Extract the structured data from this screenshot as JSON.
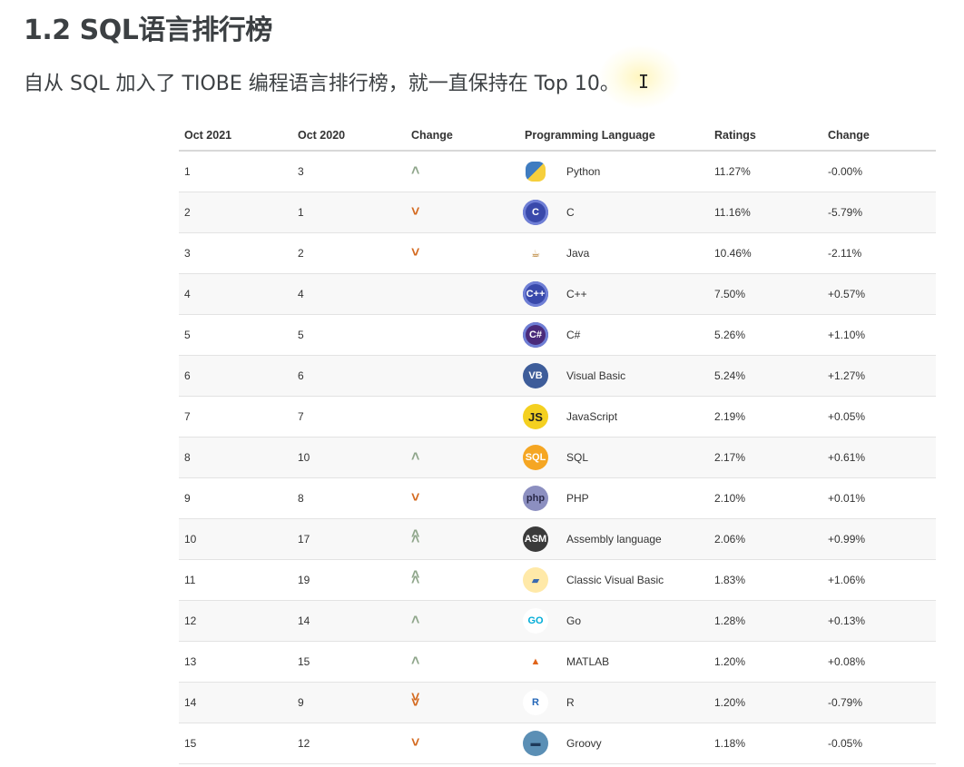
{
  "heading": "1.2 SQL语言排行榜",
  "intro": "自从 SQL 加入了 TIOBE 编程语言排行榜，就一直保持在 Top 10。",
  "cursor_glyph": "I",
  "colors": {
    "up": "#8fa68b",
    "down": "#d4691e"
  },
  "table": {
    "headers": [
      "Oct 2021",
      "Oct 2020",
      "Change",
      "Programming Language",
      "Ratings",
      "Change"
    ],
    "rows": [
      {
        "cur": "1",
        "prev": "3",
        "trend": "up",
        "lang": "Python",
        "logo": "python-logo",
        "rating": "11.27%",
        "change": "-0.00%"
      },
      {
        "cur": "2",
        "prev": "1",
        "trend": "down",
        "lang": "C",
        "logo": "c-logo",
        "rating": "11.16%",
        "change": "-5.79%"
      },
      {
        "cur": "3",
        "prev": "2",
        "trend": "down",
        "lang": "Java",
        "logo": "java-logo",
        "rating": "10.46%",
        "change": "-2.11%"
      },
      {
        "cur": "4",
        "prev": "4",
        "trend": "none",
        "lang": "C++",
        "logo": "cpp-logo",
        "rating": "7.50%",
        "change": "+0.57%"
      },
      {
        "cur": "5",
        "prev": "5",
        "trend": "none",
        "lang": "C#",
        "logo": "csharp-logo",
        "rating": "5.26%",
        "change": "+1.10%"
      },
      {
        "cur": "6",
        "prev": "6",
        "trend": "none",
        "lang": "Visual Basic",
        "logo": "visual-basic-logo",
        "rating": "5.24%",
        "change": "+1.27%"
      },
      {
        "cur": "7",
        "prev": "7",
        "trend": "none",
        "lang": "JavaScript",
        "logo": "javascript-logo",
        "rating": "2.19%",
        "change": "+0.05%"
      },
      {
        "cur": "8",
        "prev": "10",
        "trend": "up",
        "lang": "SQL",
        "logo": "sql-logo",
        "rating": "2.17%",
        "change": "+0.61%"
      },
      {
        "cur": "9",
        "prev": "8",
        "trend": "down",
        "lang": "PHP",
        "logo": "php-logo",
        "rating": "2.10%",
        "change": "+0.01%"
      },
      {
        "cur": "10",
        "prev": "17",
        "trend": "up2",
        "lang": "Assembly language",
        "logo": "assembly-logo",
        "rating": "2.06%",
        "change": "+0.99%"
      },
      {
        "cur": "11",
        "prev": "19",
        "trend": "up2",
        "lang": "Classic Visual Basic",
        "logo": "classic-visual-basic-logo",
        "rating": "1.83%",
        "change": "+1.06%"
      },
      {
        "cur": "12",
        "prev": "14",
        "trend": "up",
        "lang": "Go",
        "logo": "go-logo",
        "rating": "1.28%",
        "change": "+0.13%"
      },
      {
        "cur": "13",
        "prev": "15",
        "trend": "up",
        "lang": "MATLAB",
        "logo": "matlab-logo",
        "rating": "1.20%",
        "change": "+0.08%"
      },
      {
        "cur": "14",
        "prev": "9",
        "trend": "down2",
        "lang": "R",
        "logo": "r-logo",
        "rating": "1.20%",
        "change": "-0.79%"
      },
      {
        "cur": "15",
        "prev": "12",
        "trend": "down",
        "lang": "Groovy",
        "logo": "groovy-logo",
        "rating": "1.18%",
        "change": "-0.05%"
      }
    ]
  },
  "logo_styles": {
    "python-logo": {
      "bg": "linear-gradient(135deg,#3f7cc0 0%,#3f7cc0 50%,#f6cf3c 50%,#f6cf3c 100%)",
      "text": "",
      "color": "#fff",
      "radius": "8px",
      "size": "22px"
    },
    "c-logo": {
      "bg": "#3949ab",
      "text": "C",
      "color": "#fff",
      "radius": "50%"
    },
    "java-logo": {
      "bg": "#ffffff",
      "text": "☕",
      "color": "#b07219",
      "radius": "50%"
    },
    "cpp-logo": {
      "bg": "#3949ab",
      "text": "C++",
      "color": "#fff",
      "radius": "50%"
    },
    "csharp-logo": {
      "bg": "#4a2a7a",
      "text": "C#",
      "color": "#fff",
      "radius": "50%"
    },
    "visual-basic-logo": {
      "bg": "#3e5d9a",
      "text": "VB",
      "color": "#fff",
      "radius": "50%"
    },
    "javascript-logo": {
      "bg": "#f4d020",
      "text": "JS",
      "color": "#222",
      "radius": "50%"
    },
    "sql-logo": {
      "bg": "#f5a623",
      "text": "SQL",
      "color": "#fff",
      "radius": "50%"
    },
    "php-logo": {
      "bg": "#8c8fc0",
      "text": "php",
      "color": "#2a2a4a",
      "radius": "50%"
    },
    "assembly-logo": {
      "bg": "#3a3a3a",
      "text": "ASM",
      "color": "#fff",
      "radius": "50%"
    },
    "classic-visual-basic-logo": {
      "bg": "#ffe9a8",
      "text": "▰",
      "color": "#3a6ab0",
      "radius": "50%"
    },
    "go-logo": {
      "bg": "#ffffff",
      "text": "GO",
      "color": "#00acd7",
      "radius": "50%"
    },
    "matlab-logo": {
      "bg": "#ffffff",
      "text": "▲",
      "color": "#e0641a",
      "radius": "50%"
    },
    "r-logo": {
      "bg": "#ffffff",
      "text": "R",
      "color": "#2467b8",
      "radius": "50%"
    },
    "groovy-logo": {
      "bg": "#5b8fb5",
      "text": "▬",
      "color": "#1e3a5a",
      "radius": "50%"
    }
  }
}
